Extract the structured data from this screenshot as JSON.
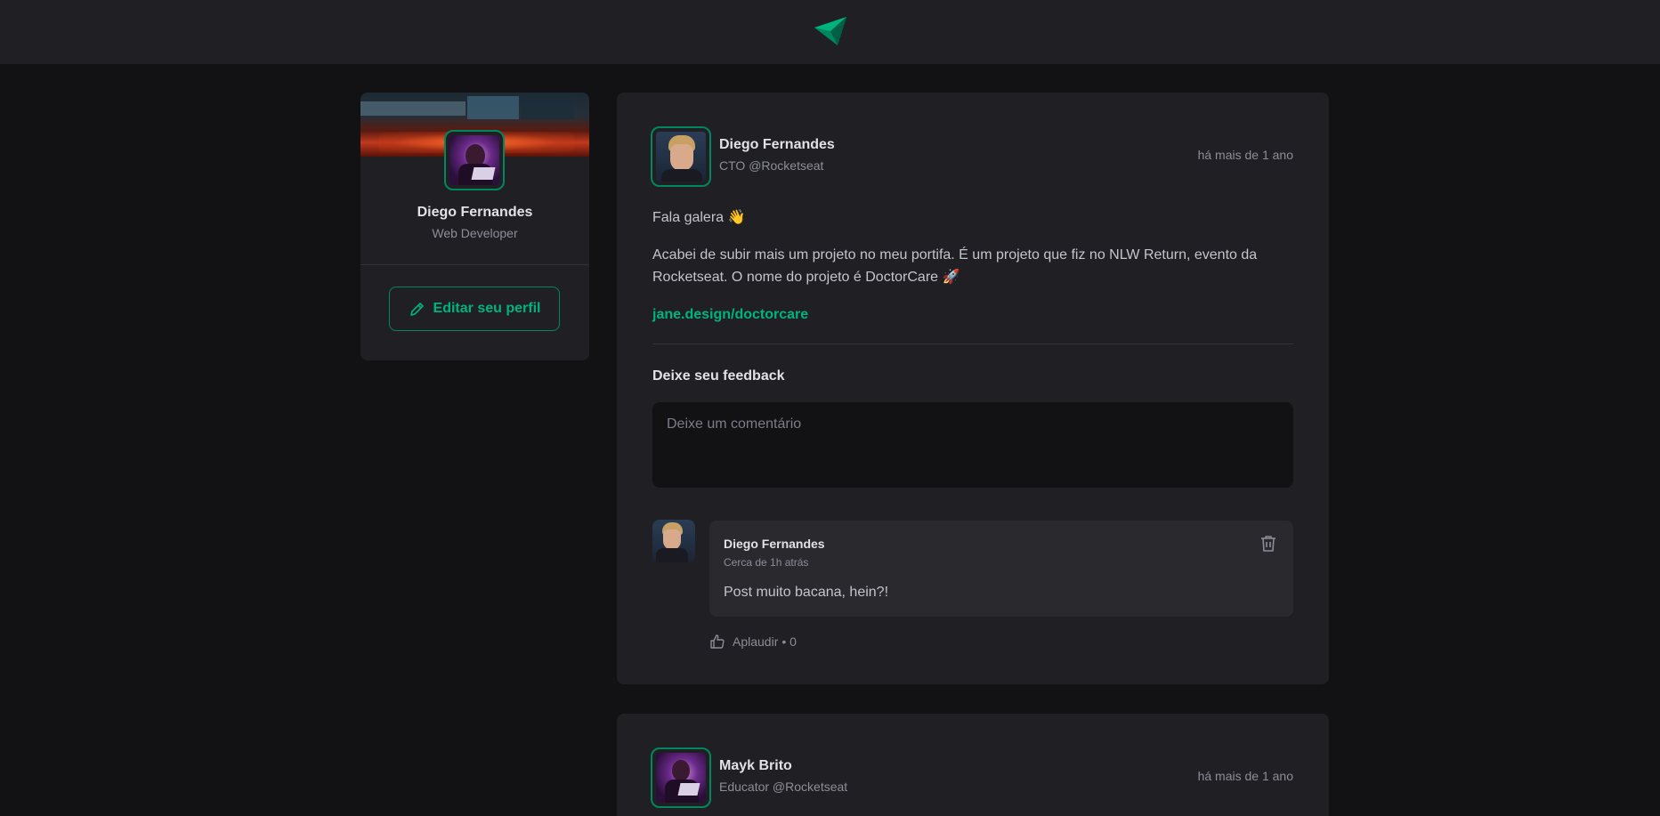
{
  "header": {
    "logo_icon": "ignite-logo-icon",
    "brand_colors": [
      "#00875f",
      "#00b37e",
      "#015f43"
    ]
  },
  "sidebar": {
    "name": "Diego Fernandes",
    "role": "Web Developer",
    "edit_button_label": "Editar seu perfil",
    "edit_icon": "pencil-icon"
  },
  "posts": [
    {
      "author": "Diego Fernandes",
      "role": "CTO @Rocketseat",
      "time": "há mais de 1 ano",
      "paragraph1": "Fala galera 👋",
      "paragraph2": "Acabei de subir mais um projeto no meu portifa. É um projeto que fiz no NLW Return, evento da Rocketseat. O nome do projeto é DoctorCare 🚀",
      "link": "jane.design/doctorcare",
      "feedback_title": "Deixe seu feedback",
      "comment_placeholder": "Deixe um comentário",
      "comments": [
        {
          "author": "Diego Fernandes",
          "time": "Cerca de 1h atrás",
          "text": "Post muito bacana, hein?!",
          "applaud_label": "Aplaudir",
          "applaud_count": "• 0"
        }
      ]
    },
    {
      "author": "Mayk Brito",
      "role": "Educator @Rocketseat",
      "time": "há mais de 1 ano"
    }
  ]
}
